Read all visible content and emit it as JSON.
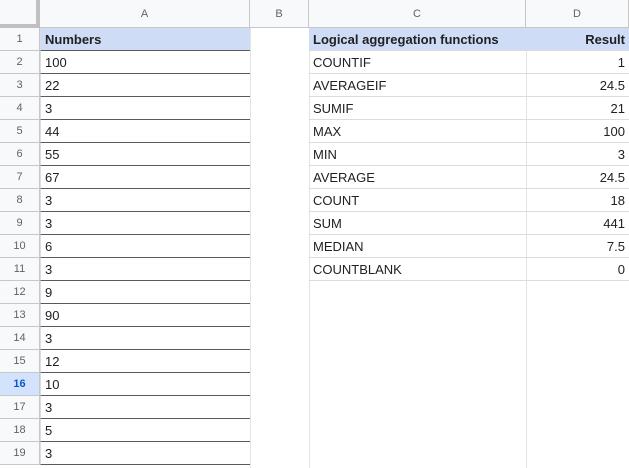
{
  "columns": [
    "A",
    "B",
    "C",
    "D"
  ],
  "rows": [
    "1",
    "2",
    "3",
    "4",
    "5",
    "6",
    "7",
    "8",
    "9",
    "10",
    "11",
    "12",
    "13",
    "14",
    "15",
    "16",
    "17",
    "18",
    "19"
  ],
  "active_row": "16",
  "colA": {
    "header": "Numbers",
    "values": [
      "100",
      "22",
      "3",
      "44",
      "55",
      "67",
      "3",
      "3",
      "6",
      "3",
      "9",
      "90",
      "3",
      "12",
      "10",
      "3",
      "5",
      "3"
    ]
  },
  "summary": {
    "header_label": "Logical aggregation functions",
    "header_result": "Result",
    "rows": [
      {
        "label": "COUNTIF",
        "value": "1"
      },
      {
        "label": "AVERAGEIF",
        "value": "24.5"
      },
      {
        "label": "SUMIF",
        "value": "21"
      },
      {
        "label": "MAX",
        "value": "100"
      },
      {
        "label": "MIN",
        "value": "3"
      },
      {
        "label": "AVERAGE",
        "value": "24.5"
      },
      {
        "label": "COUNT",
        "value": "18"
      },
      {
        "label": "SUM",
        "value": "441"
      },
      {
        "label": "MEDIAN",
        "value": "7.5"
      },
      {
        "label": "COUNTBLANK",
        "value": "0"
      }
    ]
  },
  "colors": {
    "header_fill": "#cfdcf6",
    "active_row_fill": "#d3e3fd"
  }
}
